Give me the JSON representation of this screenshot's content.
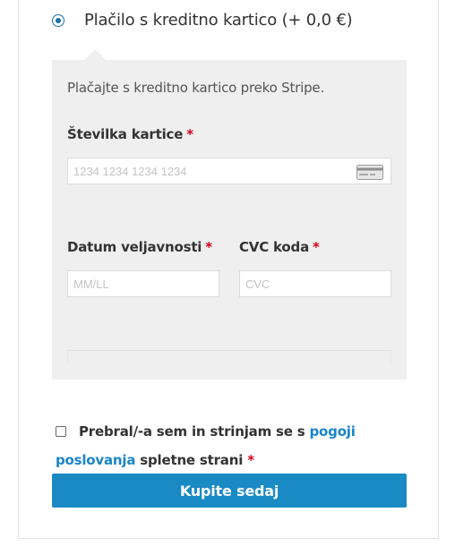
{
  "payment_option": {
    "label": "Plačilo s kreditno kartico (+ 0,0 €)",
    "selected": true
  },
  "stripe": {
    "description": "Plačajte s kreditno kartico preko Stripe.",
    "card_number": {
      "label": "Številka kartice",
      "placeholder": "1234 1234 1234 1234",
      "value": ""
    },
    "expiry": {
      "label": "Datum veljavnosti",
      "placeholder": "MM/LL",
      "value": ""
    },
    "cvc": {
      "label": "CVC koda",
      "placeholder": "CVC",
      "value": ""
    },
    "required_marker": "*"
  },
  "terms": {
    "checked": false,
    "text_before": "Prebral/-a sem in strinjam se s ",
    "link_text": "pogoji poslovanja",
    "text_after": " spletne strani",
    "required_marker": "*"
  },
  "submit": {
    "label": "Kupite sedaj"
  },
  "icons": {
    "card": "credit-card-icon"
  },
  "colors": {
    "accent": "#1a8ac4",
    "link": "#1a85c8",
    "required": "#d0021b",
    "panel": "#efefef"
  }
}
